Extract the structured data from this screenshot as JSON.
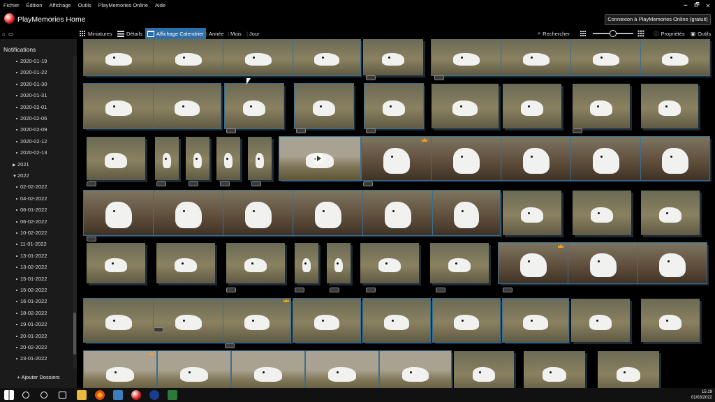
{
  "menubar": {
    "items": [
      "Fichier",
      "Édition",
      "Affichage",
      "Outils",
      "PlayMemories Online",
      "Aide"
    ]
  },
  "window_controls": {
    "minimize": "🗕",
    "restore": "🗗",
    "close": "✕"
  },
  "title": {
    "app_name": "PlayMemories Home",
    "online_button": "Connexion à PlayMemories Online (gratuit)"
  },
  "toolbar": {
    "view_miniatures": "Miniatures",
    "view_details": "Détails",
    "view_calendar": "Affichage Calendrier",
    "year": "Année",
    "month": "Mois",
    "day": "Jour",
    "search": "Rechercher",
    "properties": "Propriétés",
    "tools": "Outils",
    "zoom_level": 0.5
  },
  "sidebar": {
    "notifications": "Notifications",
    "tree": [
      {
        "label": "2020-01-19",
        "type": "item"
      },
      {
        "label": "2020-01-22",
        "type": "item"
      },
      {
        "label": "2020-01-30",
        "type": "item"
      },
      {
        "label": "2020-01-31",
        "type": "item"
      },
      {
        "label": "2020-02-01",
        "type": "item"
      },
      {
        "label": "2020-02-06",
        "type": "item"
      },
      {
        "label": "2020-02-09",
        "type": "item"
      },
      {
        "label": "2020-02-12",
        "type": "item"
      },
      {
        "label": "2020-02-13",
        "type": "item"
      },
      {
        "label": "2021",
        "type": "collapsed"
      },
      {
        "label": "2022",
        "type": "expanded"
      },
      {
        "label": "02-02-2022",
        "type": "item"
      },
      {
        "label": "04-02-2022",
        "type": "item"
      },
      {
        "label": "06-01-2022",
        "type": "item"
      },
      {
        "label": "06-02-2022",
        "type": "item"
      },
      {
        "label": "10-02-2022",
        "type": "item"
      },
      {
        "label": "11-01-2022",
        "type": "item"
      },
      {
        "label": "13-01-2022",
        "type": "item"
      },
      {
        "label": "13-02-2022",
        "type": "item"
      },
      {
        "label": "15-01-2022",
        "type": "item"
      },
      {
        "label": "15-02-2022",
        "type": "item"
      },
      {
        "label": "16-01-2022",
        "type": "item"
      },
      {
        "label": "18-02-2022",
        "type": "item"
      },
      {
        "label": "19-01-2022",
        "type": "item"
      },
      {
        "label": "20-01-2022",
        "type": "item"
      },
      {
        "label": "20-02-2022",
        "type": "item"
      },
      {
        "label": "23-01-2022",
        "type": "item"
      }
    ],
    "add_folders": "+ Ajouter Dossiers"
  },
  "taskbar": {
    "time": "15:19",
    "date": "01/03/2022"
  }
}
